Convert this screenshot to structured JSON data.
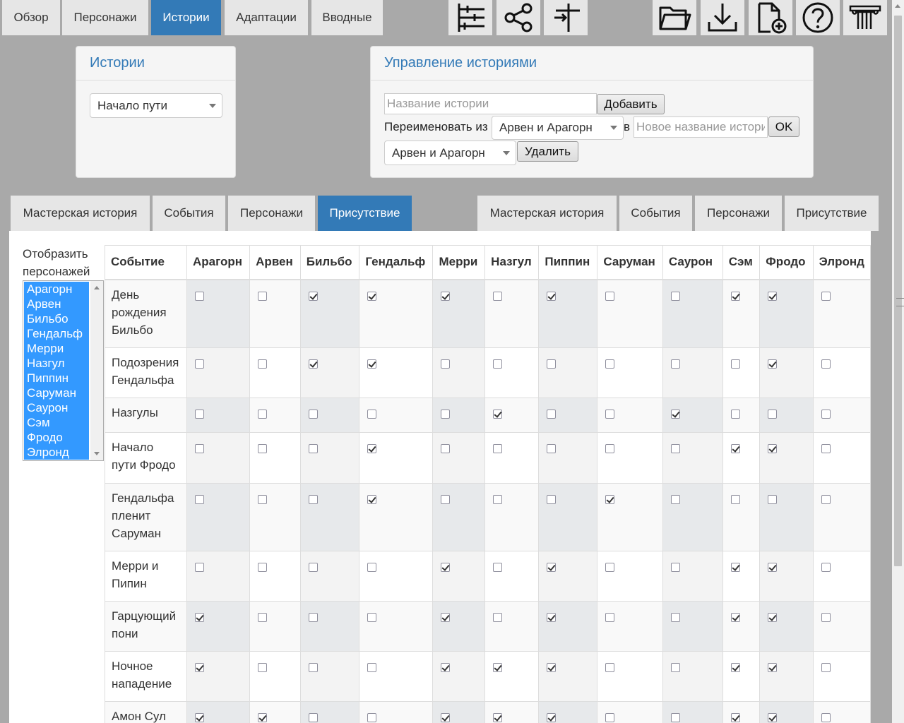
{
  "nav": {
    "tabs": [
      "Обзор",
      "Персонажи",
      "Истории",
      "Адаптации",
      "Вводные"
    ],
    "active_tab": "Истории"
  },
  "toolbar": {
    "icons": [
      "timeline-icon",
      "share-icon",
      "signpost-icon",
      "folder-icon",
      "download-icon",
      "new-file-icon",
      "help-icon",
      "columns-icon"
    ]
  },
  "stories_panel": {
    "title": "Истории",
    "selected": "Начало пути"
  },
  "manage_panel": {
    "title": "Управление историями",
    "name_placeholder": "Название истории",
    "add_label": "Добавить",
    "rename_label": "Переименовать из",
    "rename_from": "Арвен и Арагорн",
    "to_label": "в",
    "new_name_placeholder": "Новое название истории",
    "ok_label": "OK",
    "delete_select": "Арвен и Арагорн",
    "delete_label": "Удалить"
  },
  "left_tabs": [
    "Мастерская история",
    "События",
    "Персонажи",
    "Присутствие"
  ],
  "right_tabs": [
    "Мастерская история",
    "События",
    "Персонажи",
    "Присутствие"
  ],
  "active_subtab": "Присутствие",
  "display_label": "Отобразить персонажей",
  "characters_list": [
    "Арагорн",
    "Арвен",
    "Бильбо",
    "Гендальф",
    "Мерри",
    "Назгул",
    "Пиппин",
    "Саруман",
    "Саурон",
    "Сэм",
    "Фродо",
    "Элронд"
  ],
  "table": {
    "event_header": "Событие",
    "columns": [
      "Арагорн",
      "Арвен",
      "Бильбо",
      "Гендальф",
      "Мерри",
      "Назгул",
      "Пиппин",
      "Саруман",
      "Саурон",
      "Сэм",
      "Фродо",
      "Элронд"
    ],
    "rows": [
      {
        "event": "День рождения Бильбо",
        "checks": [
          0,
          0,
          1,
          1,
          1,
          0,
          1,
          0,
          0,
          1,
          1,
          0
        ]
      },
      {
        "event": "Подозрения Гендальфа",
        "checks": [
          0,
          0,
          1,
          1,
          0,
          0,
          0,
          0,
          0,
          0,
          1,
          0
        ]
      },
      {
        "event": "Назгулы",
        "checks": [
          0,
          0,
          0,
          0,
          0,
          1,
          0,
          0,
          1,
          0,
          0,
          0
        ]
      },
      {
        "event": "Начало пути Фродо",
        "checks": [
          0,
          0,
          0,
          1,
          0,
          0,
          0,
          0,
          0,
          1,
          1,
          0
        ]
      },
      {
        "event": "Гендальфа пленит Саруман",
        "checks": [
          0,
          0,
          0,
          1,
          0,
          0,
          0,
          1,
          0,
          0,
          0,
          0
        ]
      },
      {
        "event": "Мерри и Пипин",
        "checks": [
          0,
          0,
          0,
          0,
          1,
          0,
          1,
          0,
          0,
          1,
          1,
          0
        ]
      },
      {
        "event": "Гарцующий пони",
        "checks": [
          1,
          0,
          0,
          0,
          1,
          0,
          1,
          0,
          0,
          1,
          1,
          0
        ]
      },
      {
        "event": "Ночное нападение",
        "checks": [
          1,
          0,
          0,
          0,
          1,
          1,
          1,
          0,
          0,
          1,
          1,
          0
        ]
      },
      {
        "event": "Амон Сул",
        "checks": [
          1,
          1,
          0,
          0,
          1,
          1,
          1,
          0,
          0,
          1,
          1,
          0
        ]
      }
    ]
  }
}
